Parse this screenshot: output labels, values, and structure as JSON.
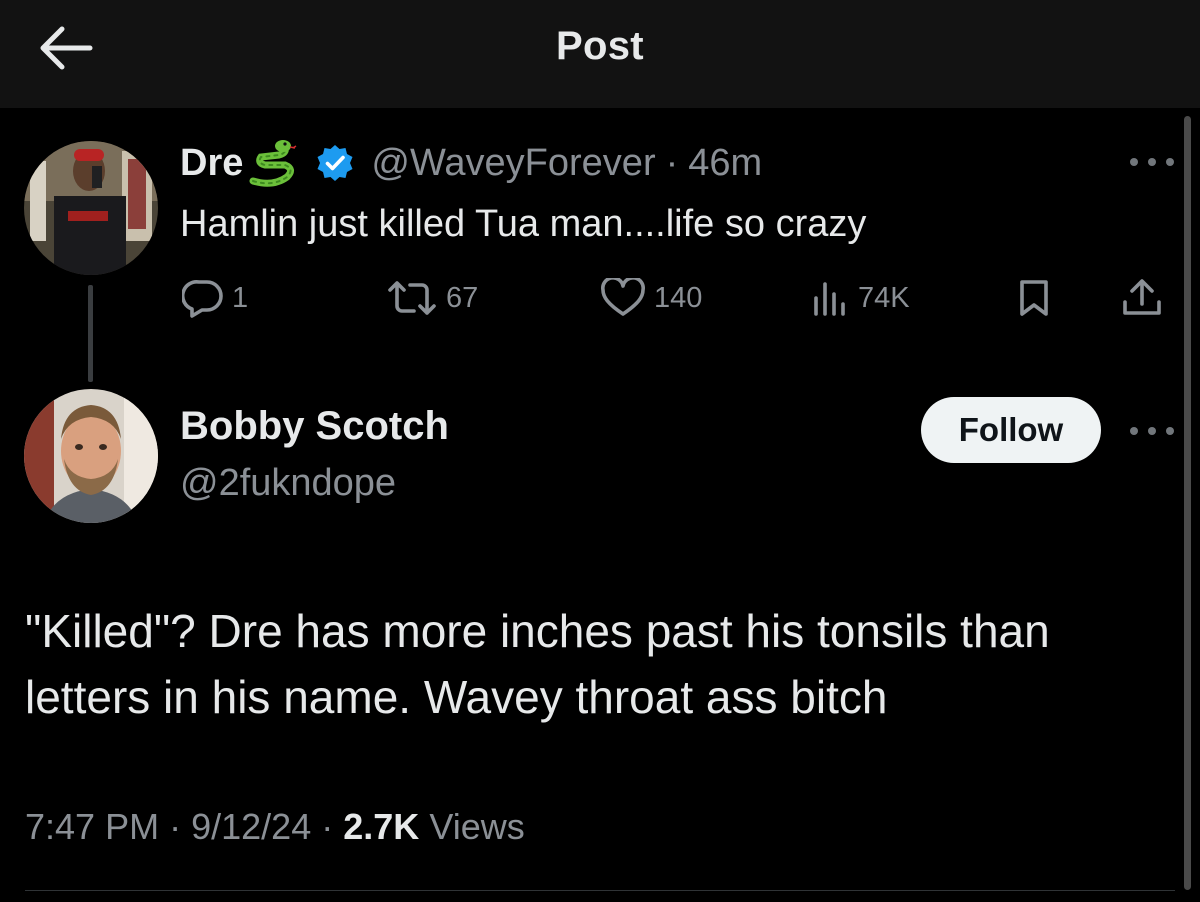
{
  "header": {
    "title": "Post",
    "back_icon": "arrow-left-icon"
  },
  "parent_tweet": {
    "display_name": "Dre",
    "name_emoji": "snake-emoji",
    "verified": true,
    "verified_color": "#1d9bf0",
    "handle": "@WaveyForever",
    "separator": "·",
    "time_ago": "46m",
    "text": "Hamlin just killed Tua man....life so crazy",
    "actions": {
      "replies": "1",
      "reposts": "67",
      "likes": "140",
      "views": "74K"
    }
  },
  "reply_tweet": {
    "display_name": "Bobby Scotch",
    "handle": "@2fukndope",
    "follow_label": "Follow",
    "text": "\"Killed\"? Dre has more inches past his tonsils than letters in his name. Wavey throat ass bitch",
    "time": "7:47 PM",
    "date": "9/12/24",
    "separator": "·",
    "views_count": "2.7K",
    "views_label": "Views"
  },
  "colors": {
    "background": "#000000",
    "header_background": "#121212",
    "primary_text": "#e7e9ea",
    "secondary_text": "#8b9096",
    "follow_button_bg": "#eff3f4"
  }
}
